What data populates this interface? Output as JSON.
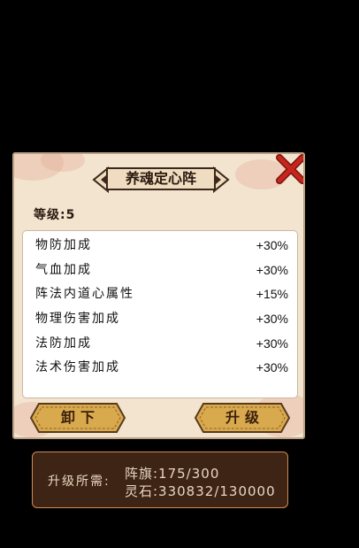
{
  "title": "养魂定心阵",
  "close_icon": "close-x-icon",
  "level": {
    "label": "等级:",
    "value": "5"
  },
  "attributes": [
    {
      "name": "物防加成",
      "value": "+30%"
    },
    {
      "name": "气血加成",
      "value": "+30%"
    },
    {
      "name": "阵法内道心属性",
      "value": "+15%"
    },
    {
      "name": "物理伤害加成",
      "value": "+30%"
    },
    {
      "name": "法防加成",
      "value": "+30%"
    },
    {
      "name": "法术伤害加成",
      "value": "+30%"
    }
  ],
  "buttons": {
    "unequip": "卸下",
    "upgrade": "升级"
  },
  "requirement": {
    "label": "升级所需:",
    "flag": "阵旗:175/300",
    "stone": "灵石:330832/130000"
  },
  "colors": {
    "panel_bg": "#f3e4cf",
    "close_red": "#c8261c",
    "button_gold": "#d9a94e",
    "requirement_bg": "#3d2414",
    "requirement_border": "#d08a52"
  }
}
